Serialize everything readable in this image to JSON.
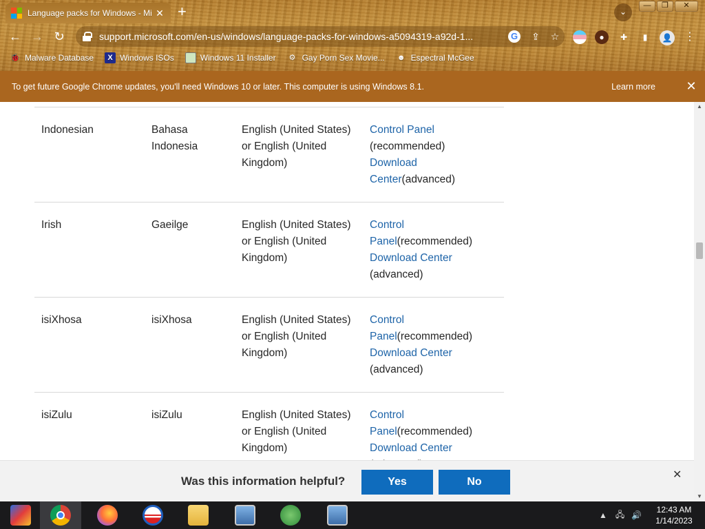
{
  "browser": {
    "tab_title": "Language packs for Windows - Mi",
    "tab_close": "✕",
    "new_tab": "+",
    "url": "support.microsoft.com/en-us/windows/language-packs-for-windows-a5094319-a92d-1...",
    "window_controls": {
      "minimize": "—",
      "restore": "❐",
      "close": "✕"
    }
  },
  "bookmarks": [
    {
      "label": "Malware Database",
      "icon": "bug-icon"
    },
    {
      "label": "Windows ISOs",
      "icon": "x-logo-icon"
    },
    {
      "label": "Windows 11 Installer",
      "icon": "image-icon"
    },
    {
      "label": "Gay Porn Sex Movie...",
      "icon": "site-icon"
    },
    {
      "label": "Espectral McGee",
      "icon": "ghost-icon"
    }
  ],
  "infobar": {
    "message": "To get future Google Chrome updates, you'll need Windows 10 or later. This computer is using Windows 8.1.",
    "learn_more": "Learn more",
    "close": "✕"
  },
  "table": {
    "rows": [
      {
        "language": "Indonesian",
        "native": "Bahasa Indonesia",
        "base": "English (United States) or English (United Kingdom)",
        "cp_link": "Control Panel",
        "cp_note": " (recommended)",
        "dl_link": "Download Center",
        "dl_note": "(advanced)"
      },
      {
        "language": "Irish",
        "native": "Gaeilge",
        "base": "English (United States) or English (United Kingdom)",
        "cp_link": "Control Panel",
        "cp_note": "(recommended)",
        "dl_link": "Download Center",
        "dl_note": "(advanced)"
      },
      {
        "language": "isiXhosa",
        "native": "isiXhosa",
        "base": "English (United States) or English (United Kingdom)",
        "cp_link": "Control Panel",
        "cp_note": "(recommended)",
        "dl_link": "Download Center",
        "dl_note": "(advanced)"
      },
      {
        "language": "isiZulu",
        "native": "isiZulu",
        "base": "English (United States) or English (United Kingdom)",
        "cp_link": "Control Panel",
        "cp_note": "(recommended)",
        "dl_link": "Download Center",
        "dl_note": "(advanced)"
      }
    ]
  },
  "feedback": {
    "question": "Was this information helpful?",
    "yes": "Yes",
    "no": "No",
    "close": "✕"
  },
  "taskbar": {
    "time": "12:43 AM",
    "date": "1/14/2023",
    "apps": [
      "start-icon",
      "chrome-icon",
      "firefox-icon",
      "obama-logo-icon",
      "file-explorer-icon",
      "network-computer-icon",
      "users-icon",
      "network-computer-icon-2"
    ]
  },
  "colors": {
    "link": "#1e64a8",
    "infobar_bg": "#aa661f",
    "feedback_button": "#0f6cbd",
    "taskbar_bg": "#1a1a1c"
  }
}
